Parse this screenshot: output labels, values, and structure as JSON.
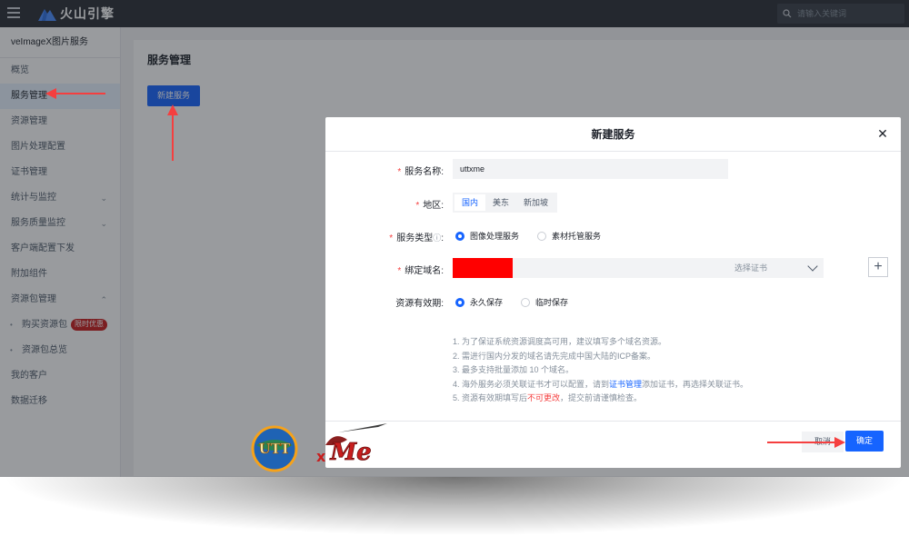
{
  "topbar": {
    "logo_text": "火山引擎",
    "search_placeholder": "请输入关键词"
  },
  "sidebar": {
    "title": "veImageX图片服务",
    "items": [
      {
        "label": "概览"
      },
      {
        "label": "服务管理",
        "active": true
      },
      {
        "label": "资源管理"
      },
      {
        "label": "图片处理配置"
      },
      {
        "label": "证书管理"
      },
      {
        "label": "统计与监控",
        "chevron": "down"
      },
      {
        "label": "服务质量监控",
        "chevron": "down"
      },
      {
        "label": "客户端配置下发"
      },
      {
        "label": "附加组件"
      },
      {
        "label": "资源包管理",
        "chevron": "up"
      },
      {
        "label": "购买资源包",
        "badge": "限时优惠",
        "sub": true
      },
      {
        "label": "资源包总览",
        "sub": true
      },
      {
        "label": "我的客户"
      },
      {
        "label": "数据迁移"
      }
    ]
  },
  "main": {
    "title": "服务管理",
    "create_button": "新建服务"
  },
  "modal": {
    "title": "新建服务",
    "service_name": {
      "label": "服务名称:",
      "value": "uttxme"
    },
    "region": {
      "label": "地区:",
      "options": [
        "国内",
        "美东",
        "新加坡"
      ],
      "selected": "国内"
    },
    "service_type": {
      "label": "服务类型",
      "options": [
        "图像处理服务",
        "素材托管服务"
      ],
      "selected": "图像处理服务"
    },
    "domain": {
      "label": "绑定域名:",
      "cert_placeholder": "选择证书"
    },
    "validity": {
      "label": "资源有效期:",
      "options": [
        "永久保存",
        "临时保存"
      ],
      "selected": "永久保存"
    },
    "notes": {
      "n1": "1. 为了保证系统资源调度高可用，建议填写多个域名资源。",
      "n2": "2. 需进行国内分发的域名请先完成中国大陆的ICP备案。",
      "n3": "3. 最多支持批量添加 10 个域名。",
      "n4_a": "4. 海外服务必须关联证书才可以配置，请到",
      "n4_link": "证书管理",
      "n4_b": "添加证书，再选择关联证书。",
      "n5_a": "5. 资源有效期填写后",
      "n5_red": "不可更改",
      "n5_b": "，提交前请谨慎检查。"
    },
    "cancel_button": "取消",
    "ok_button": "确定"
  },
  "colors": {
    "accent": "#1664ff",
    "topbar": "#2b2f36",
    "annotation_arrow": "#f53f3f"
  }
}
